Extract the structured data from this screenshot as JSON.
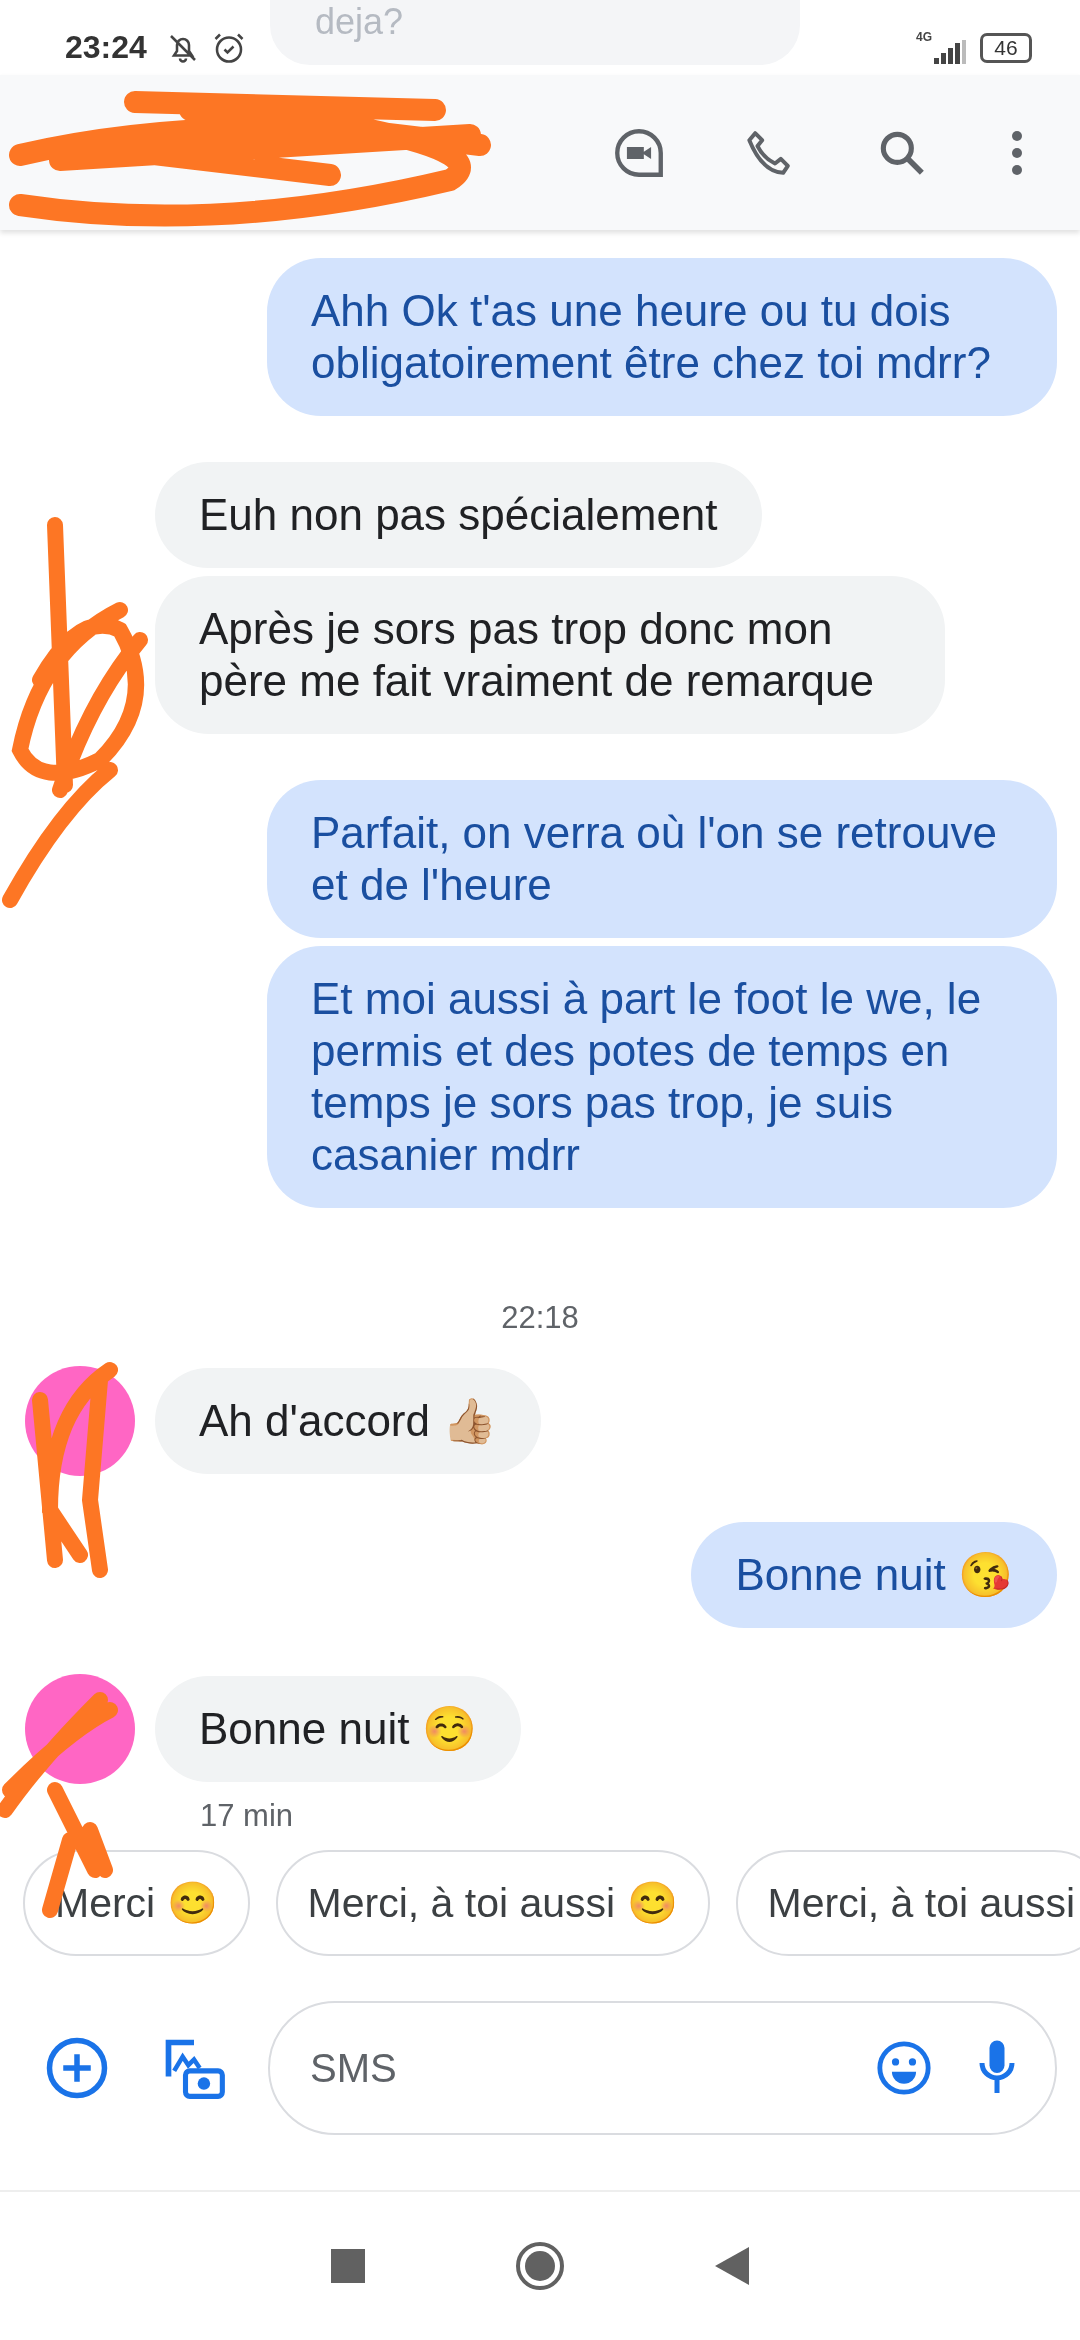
{
  "status_bar": {
    "time": "23:24",
    "network": "4G",
    "battery": "46",
    "peek_message": "deja?"
  },
  "conversation": [
    {
      "kind": "message",
      "outgoing": true,
      "text": "Ahh Ok t'as une heure ou tu dois obligatoirement être chez toi mdrr?"
    },
    {
      "kind": "message",
      "outgoing": false,
      "text": "Euh non pas spécialement"
    },
    {
      "kind": "message",
      "outgoing": false,
      "text": "Après je sors pas trop donc mon père me fait vraiment de remarque"
    },
    {
      "kind": "message",
      "outgoing": true,
      "text": "Parfait, on verra où l'on se retrouve et de l'heure"
    },
    {
      "kind": "message",
      "outgoing": true,
      "text": "Et moi aussi à part le foot le we, le permis et des potes de temps en temps je sors pas trop, je suis casanier mdrr"
    },
    {
      "kind": "timestamp",
      "text": "22:18"
    },
    {
      "kind": "message",
      "outgoing": false,
      "text": "Ah d'accord 👍🏼",
      "avatar": true
    },
    {
      "kind": "message",
      "outgoing": true,
      "text": "Bonne nuit 😘"
    },
    {
      "kind": "message",
      "outgoing": false,
      "text": "Bonne nuit ☺️",
      "avatar": true,
      "meta": "17 min"
    }
  ],
  "suggestions": [
    {
      "text": "Merci 😊"
    },
    {
      "text": "Merci, à toi aussi 😊"
    },
    {
      "text": "Merci, à toi aussi"
    }
  ],
  "compose": {
    "placeholder": "SMS"
  }
}
